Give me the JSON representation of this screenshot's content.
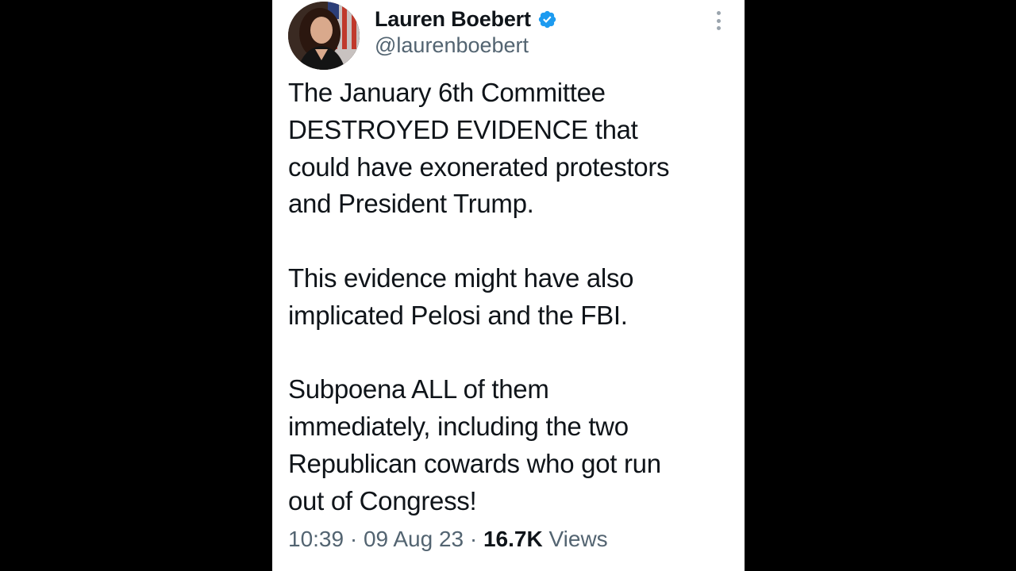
{
  "user": {
    "display_name": "Lauren Boebert",
    "handle": "@laurenboebert",
    "verified": true
  },
  "tweet": {
    "paragraphs": [
      [
        "The January 6th Committee",
        "DESTROYED EVIDENCE that",
        "could have exonerated protestors",
        "and President Trump."
      ],
      [
        "This evidence might have also",
        "implicated Pelosi and the FBI."
      ],
      [
        "Subpoena ALL of them",
        "immediately, including the two",
        "Republican cowards who got run",
        "out of Congress!"
      ]
    ]
  },
  "meta": {
    "time": "10:39",
    "sep1": " · ",
    "date": "09 Aug 23",
    "sep2": " · ",
    "views_count": "16.7K",
    "views_label": " Views"
  },
  "icons": {
    "verified": "verified-badge-icon",
    "more": "more-options-icon"
  },
  "colors": {
    "verified_blue": "#1d9bf0",
    "secondary_text": "#536471",
    "primary_text": "#0f1419"
  }
}
